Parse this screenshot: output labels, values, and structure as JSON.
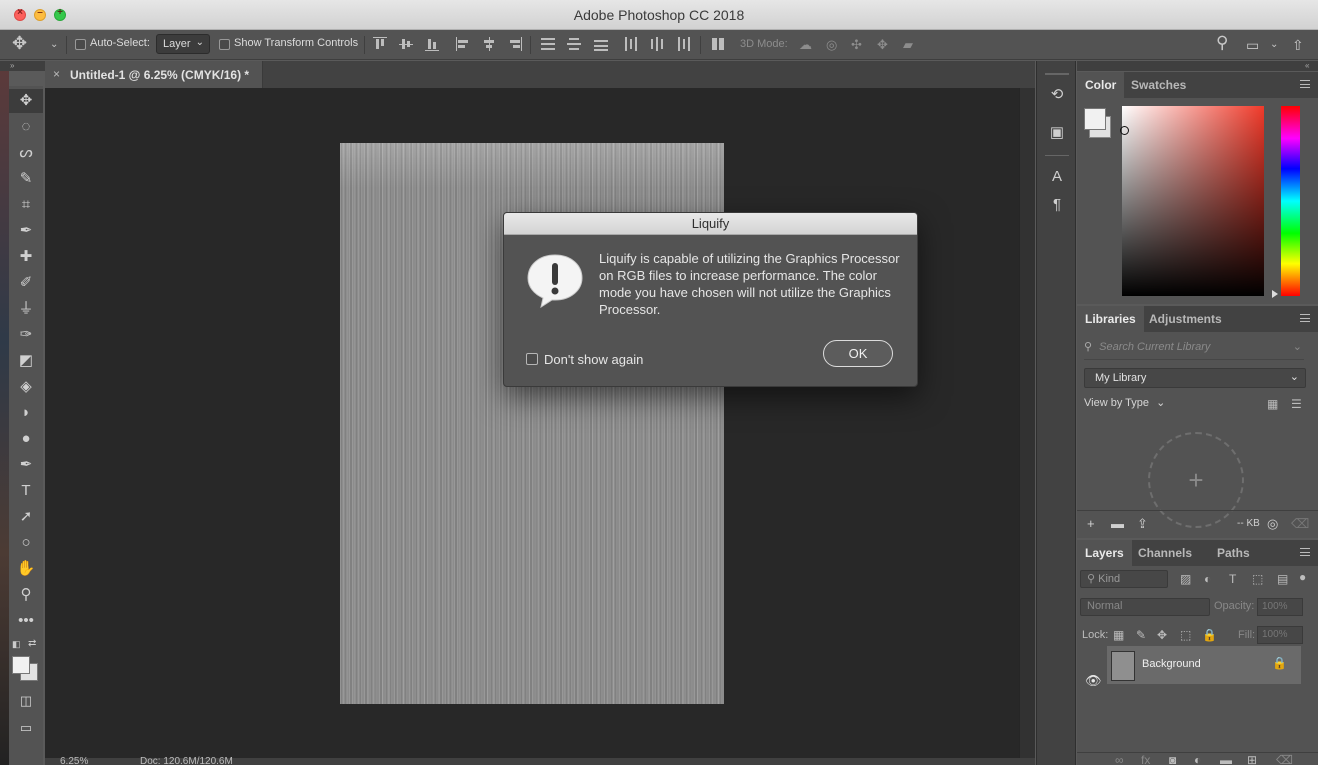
{
  "app": {
    "title": "Adobe Photoshop CC 2018"
  },
  "options_bar": {
    "auto_select_label": "Auto-Select:",
    "layer_dropdown": "Layer",
    "show_transform_label": "Show Transform Controls",
    "mode_3d_label": "3D Mode:"
  },
  "document": {
    "tab_title": "Untitled-1 @ 6.25% (CMYK/16) *",
    "zoom": "6.25%",
    "doc_info": "Doc: 120.6M/120.6M"
  },
  "dialog": {
    "title": "Liquify",
    "message": "Liquify is capable of utilizing the Graphics Processor on RGB files to increase performance. The color mode you have chosen will not utilize the Graphics Processor.",
    "checkbox_label": "Don't show again",
    "ok_label": "OK"
  },
  "color_panel": {
    "tabs": [
      "Color",
      "Swatches"
    ],
    "foreground": "#f1f1f1",
    "background": "#e2e2e2"
  },
  "libraries_panel": {
    "tabs": [
      "Libraries",
      "Adjustments"
    ],
    "search_placeholder": "Search Current Library",
    "library": "My Library",
    "view_by": "View by Type",
    "size": "-- KB"
  },
  "layers_panel": {
    "tabs": [
      "Layers",
      "Channels",
      "Paths"
    ],
    "kind_placeholder": "Kind",
    "blend_mode": "Normal",
    "opacity_label": "Opacity:",
    "opacity_value": "100%",
    "lock_label": "Lock:",
    "fill_label": "Fill:",
    "fill_value": "100%",
    "layers": [
      {
        "name": "Background",
        "visible": true,
        "locked": true
      }
    ]
  }
}
